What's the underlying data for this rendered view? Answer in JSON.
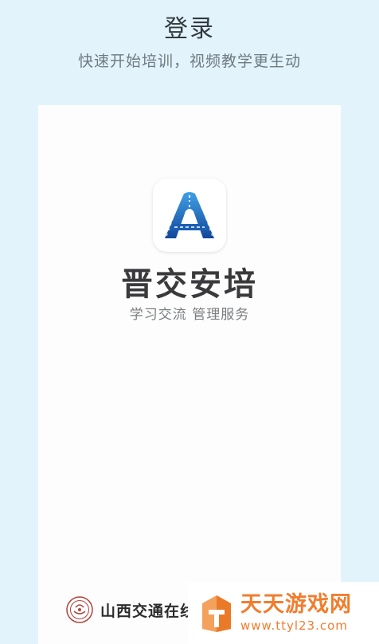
{
  "header": {
    "title": "登录",
    "subtitle": "快速开始培训，视频教学更生动"
  },
  "brand": {
    "icon": "road-arch-logo-icon",
    "name": "晋交安培",
    "slogan": "学习交流 管理服务"
  },
  "footer": {
    "org_icon": "seal-logo-icon",
    "org_name": "山西交通在线"
  },
  "watermark": {
    "icon": "orange-tower-logo-icon",
    "title": "天天游戏网",
    "url": "www.ttyl23.com"
  },
  "colors": {
    "background": "#e2f3fb",
    "card": "#fdfdfd",
    "logo_blue": "#1f6fc0",
    "watermark_orange": "#f07d2e"
  }
}
